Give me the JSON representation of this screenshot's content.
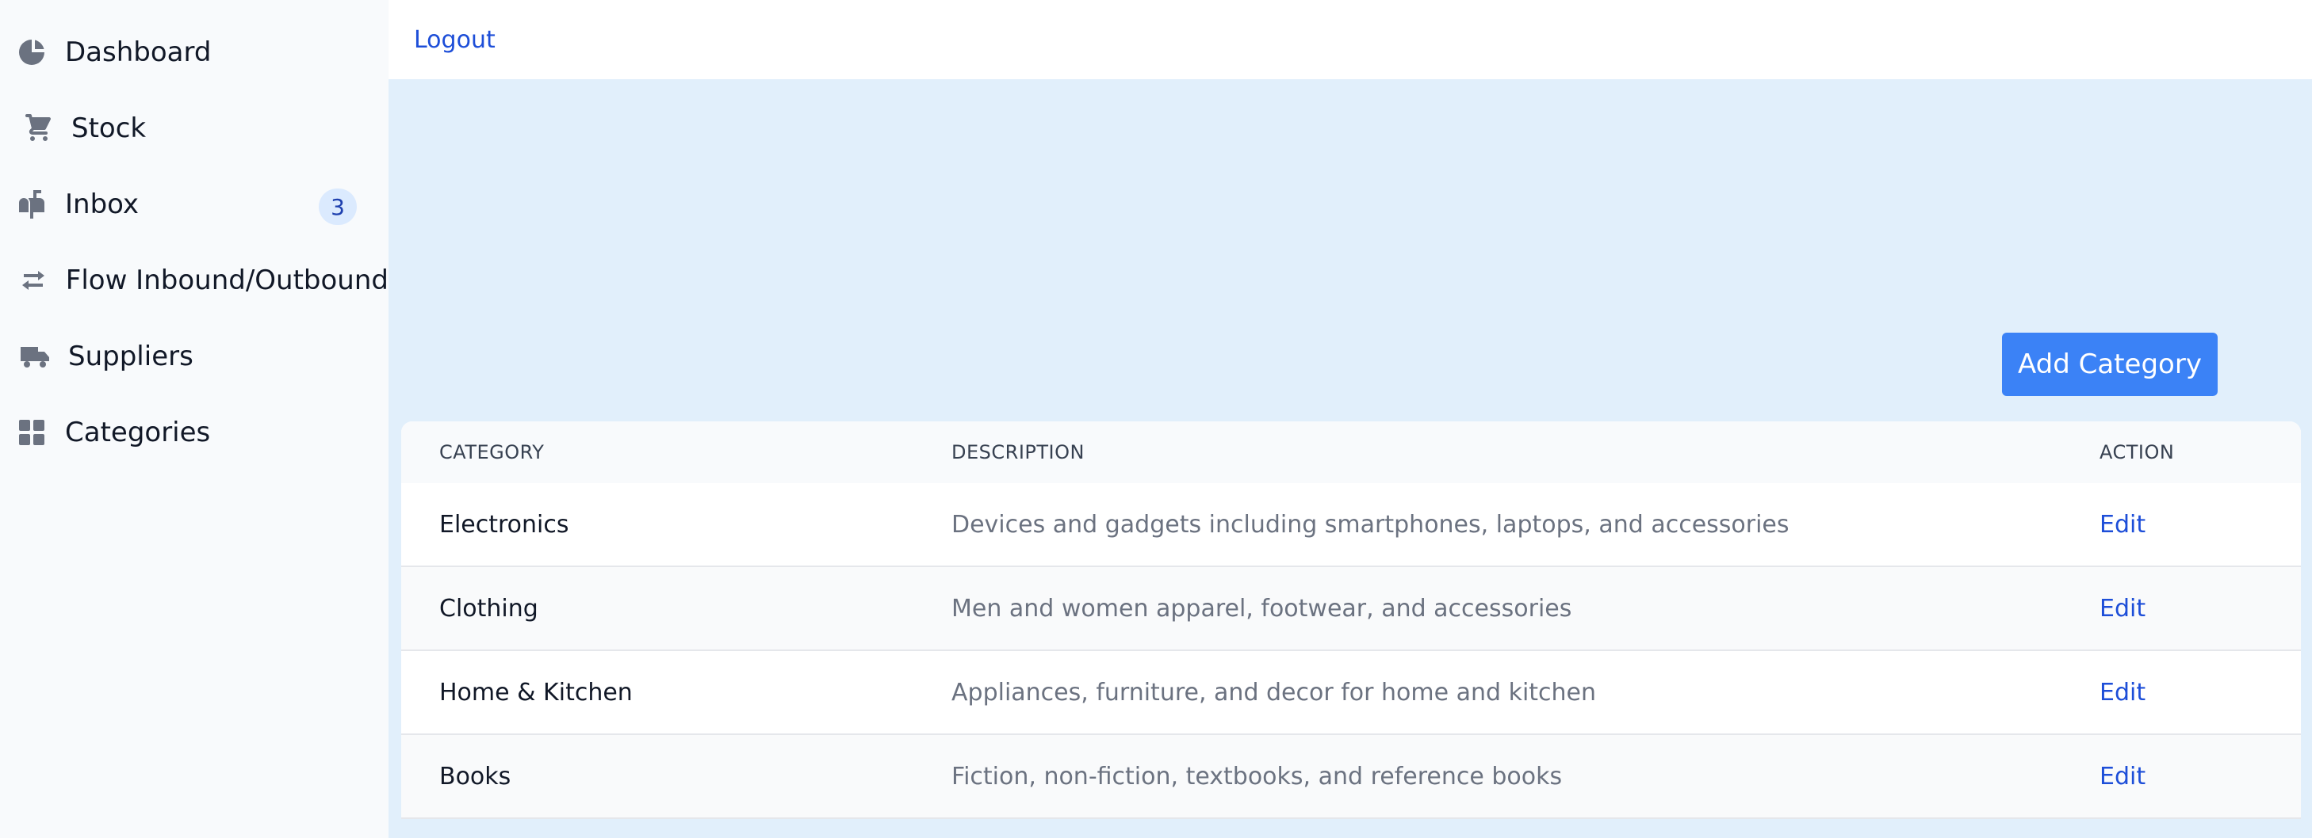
{
  "sidebar": {
    "items": [
      {
        "label": "Dashboard",
        "icon": "pie-chart-icon"
      },
      {
        "label": "Stock",
        "icon": "cart-icon"
      },
      {
        "label": "Inbox",
        "icon": "mailbox-icon",
        "badge": "3"
      },
      {
        "label": "Flow Inbound/Outbound",
        "icon": "arrows-exchange-icon"
      },
      {
        "label": "Suppliers",
        "icon": "truck-icon"
      },
      {
        "label": "Categories",
        "icon": "grid-icon"
      }
    ]
  },
  "header": {
    "logout_label": "Logout"
  },
  "toolbar": {
    "add_category_label": "Add Category"
  },
  "table": {
    "headers": [
      "CATEGORY",
      "DESCRIPTION",
      "ACTION"
    ],
    "rows": [
      {
        "category": "Electronics",
        "description": "Devices and gadgets including smartphones, laptops, and accessories",
        "action": "Edit"
      },
      {
        "category": "Clothing",
        "description": "Men and women apparel, footwear, and accessories",
        "action": "Edit"
      },
      {
        "category": "Home & Kitchen",
        "description": "Appliances, furniture, and decor for home and kitchen",
        "action": "Edit"
      },
      {
        "category": "Books",
        "description": "Fiction, non-fiction, textbooks, and reference books",
        "action": "Edit"
      }
    ]
  },
  "colors": {
    "accent": "#3b82f6",
    "link": "#1d4ed8",
    "content_bg": "#e1effb",
    "sidebar_bg": "#f8fafc"
  }
}
